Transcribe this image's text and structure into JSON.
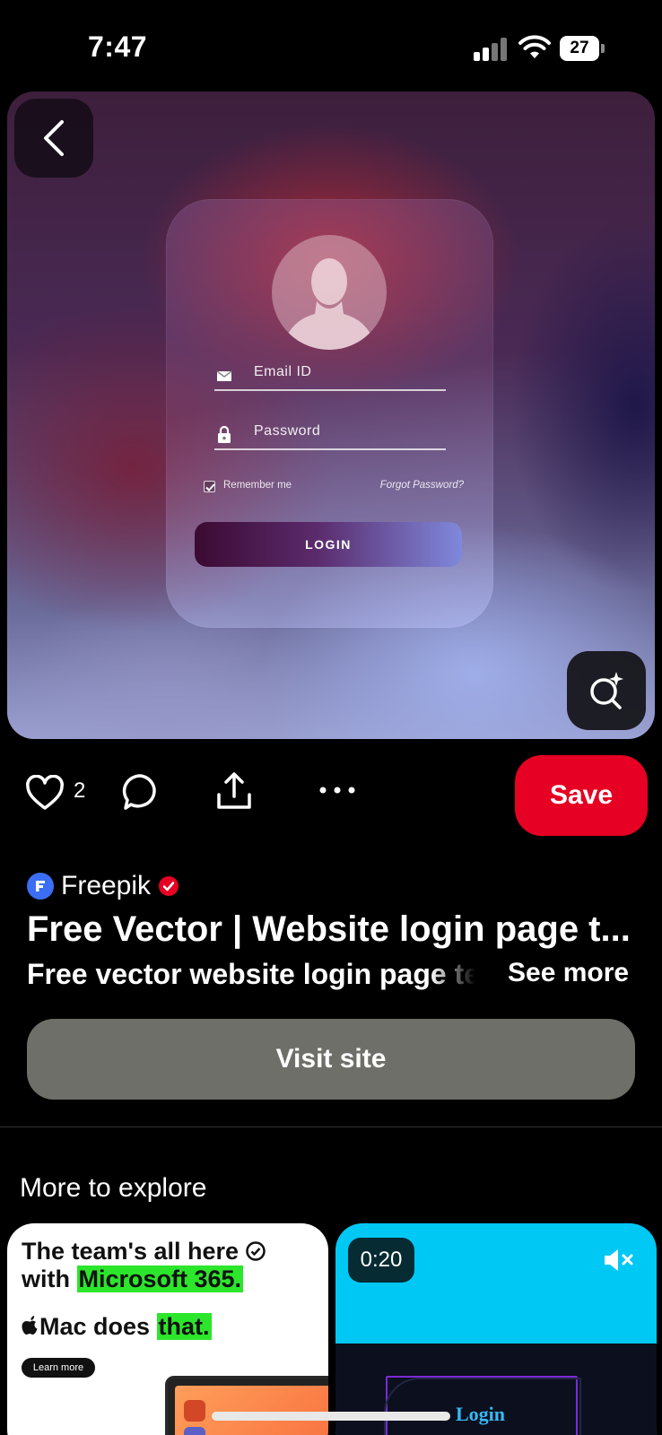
{
  "status_bar": {
    "time": "7:47",
    "battery": "27"
  },
  "pin": {
    "login_card": {
      "email_label": "Email ID",
      "password_label": "Password",
      "remember_label": "Remember me",
      "forgot_label": "Forgot Password?",
      "login_label": "LOGIN"
    }
  },
  "actions": {
    "like_count": "2",
    "save_label": "Save"
  },
  "creator": {
    "name": "Freepik",
    "verified": true
  },
  "title": "Free Vector | Website login page t...",
  "description": "Free vector website login page template",
  "see_more_label": "See more",
  "visit_label": "Visit site",
  "section_title": "More to explore",
  "cards": {
    "ad": {
      "headline_part1": "The team's all here",
      "headline_part2": "with ",
      "headline_highlight": "Microsoft 365.",
      "sub_part1": "Mac does ",
      "sub_highlight": "that.",
      "learn_more_label": "Learn more"
    },
    "video": {
      "duration": "0:20",
      "login_text": "Login"
    }
  },
  "colors": {
    "save_red": "#e60023",
    "visit_gray": "#6f6f6a",
    "highlight_green": "#2ce62c",
    "video_cyan": "#00c8f5"
  }
}
